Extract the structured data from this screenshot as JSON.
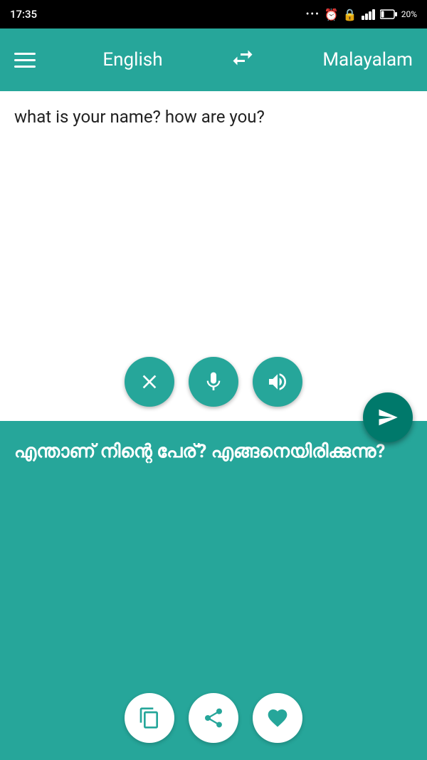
{
  "statusBar": {
    "time": "17:35",
    "battery": "20%"
  },
  "navbar": {
    "sourceLang": "English",
    "targetLang": "Malayalam",
    "menuIcon": "menu-icon",
    "swapIcon": "swap-icon"
  },
  "inputPanel": {
    "text": "what is your name? how are you?",
    "clearButton": "clear-button",
    "micButton": "mic-button",
    "speakerButton": "speaker-button"
  },
  "sendButton": {
    "label": "send-button"
  },
  "outputPanel": {
    "text": "എന്താണ് നിന്റെ പേര്? എങ്ങനെയിരിക്കുന്നു?",
    "copyButton": "copy-button",
    "shareButton": "share-button",
    "favoriteButton": "favorite-button"
  }
}
